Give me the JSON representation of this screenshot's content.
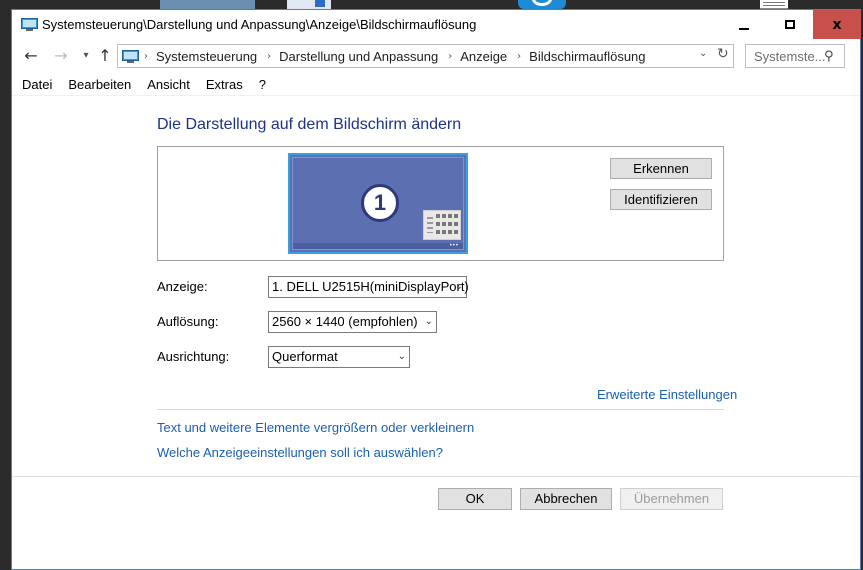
{
  "window": {
    "title": "Systemsteuerung\\Darstellung und Anpassung\\Anzeige\\Bildschirmauflösung",
    "minimize_symbol": "",
    "maximize_symbol": "",
    "close_symbol": "x"
  },
  "nav": {
    "back_icon": "arrow-left-icon",
    "forward_icon": "arrow-right-icon",
    "recent_icon": "chevron-down-icon",
    "up_icon": "arrow-up-icon",
    "breadcrumbs": [
      "Systemsteuerung",
      "Darstellung und Anpassung",
      "Anzeige",
      "Bildschirmauflösung"
    ],
    "search_placeholder": "Systemste..."
  },
  "menu": [
    "Datei",
    "Bearbeiten",
    "Ansicht",
    "Extras",
    "?"
  ],
  "main": {
    "heading": "Die Darstellung auf dem Bildschirm ändern",
    "monitor_number": "1",
    "detect_button": "Erkennen",
    "identify_button": "Identifizieren",
    "display_label": "Anzeige:",
    "display_value": "1. DELL U2515H(miniDisplayPort)",
    "resolution_label": "Auflösung:",
    "resolution_value": "2560 × 1440 (empfohlen)",
    "orientation_label": "Ausrichtung:",
    "orientation_value": "Querformat",
    "advanced_link": "Erweiterte Einstellungen",
    "text_size_link": "Text und weitere Elemente vergrößern oder verkleinern",
    "which_settings_link": "Welche Anzeigeeinstellungen soll ich auswählen?"
  },
  "footer": {
    "ok": "OK",
    "cancel": "Abbrechen",
    "apply": "Übernehmen"
  },
  "colors": {
    "heading": "#1e3287",
    "link": "#1a5fb4",
    "close_button": "#c7504a",
    "monitor_fill": "#5c6fb0",
    "monitor_border": "#39a0e0"
  }
}
